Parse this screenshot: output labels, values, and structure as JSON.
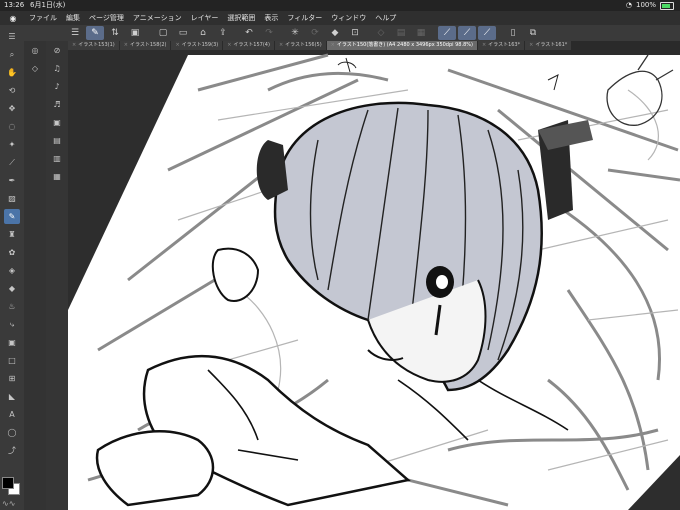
{
  "status_bar": {
    "time": "13:26",
    "date": "6月1日(水)",
    "battery": "100%"
  },
  "menu": {
    "items": [
      "ファイル",
      "編集",
      "ページ管理",
      "アニメーション",
      "レイヤー",
      "選択範囲",
      "表示",
      "フィルター",
      "ウィンドウ",
      "ヘルプ"
    ]
  },
  "toolbar": {
    "icons": [
      "menu-icon",
      "pen-active-icon",
      "link-icon",
      "new-file-icon",
      "open-folder-icon",
      "save-icon",
      "undo-icon",
      "redo-icon",
      "fill-icon",
      "transform-icon",
      "clear-icon",
      "fill-layer-icon",
      "select-icon",
      "line-icon",
      "curve-icon",
      "stroke-icon",
      "canvas-icon",
      "shortcut-icon"
    ]
  },
  "tabs": [
    {
      "label": "イラスト153(1)",
      "active": false
    },
    {
      "label": "イラスト158(2)",
      "active": false
    },
    {
      "label": "イラスト159(3)",
      "active": false
    },
    {
      "label": "イラスト157(4)",
      "active": false
    },
    {
      "label": "イラスト156(5)",
      "active": false
    },
    {
      "label": "イラスト150(落書き) (A4 2480 x 3496px 350dpi 98.8%)",
      "active": true
    },
    {
      "label": "イラスト163*",
      "active": false
    },
    {
      "label": "イラスト161*",
      "active": false
    }
  ],
  "left_tools": [
    "menu-icon",
    "zoom-icon",
    "hand-icon",
    "rotate-icon",
    "move-icon",
    "lasso-icon",
    "wand-icon",
    "eyedropper-icon",
    "pen-icon",
    "pencil-icon",
    "brush-icon",
    "airbrush-icon",
    "decoration-icon",
    "eraser-icon",
    "blend-icon",
    "fill-icon",
    "gradient-icon",
    "figure-icon",
    "frame-icon",
    "ruler-icon",
    "text-icon",
    "balloon-icon",
    "correction-icon"
  ],
  "subtool_icons": [
    "layer-icon",
    "search-icon",
    "brush-size-icon",
    "settings-icon",
    "tool-a-icon",
    "tool-b-icon",
    "tool-c-icon",
    "tool-d-icon",
    "tool-e-icon"
  ],
  "colors": {
    "foreground": "#000000",
    "background": "#ffffff",
    "accent": "#4b74a8"
  }
}
